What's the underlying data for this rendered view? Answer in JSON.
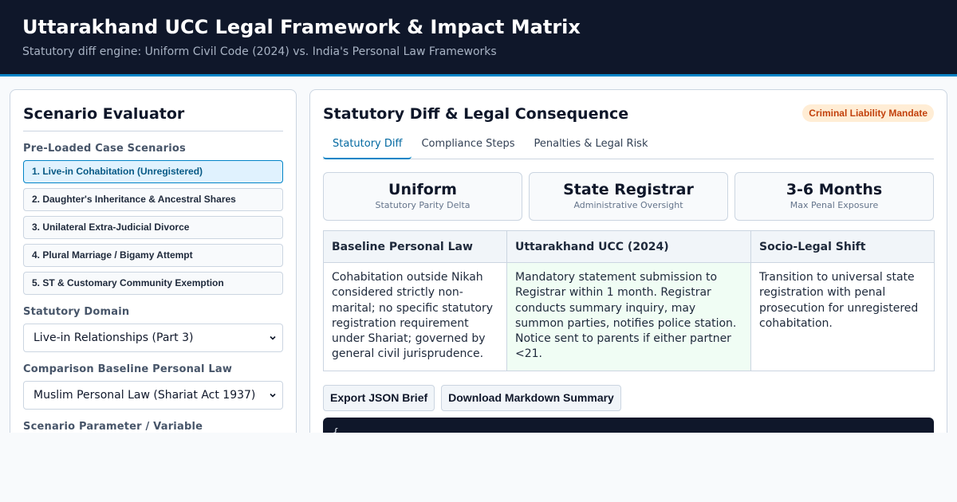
{
  "header": {
    "title": "Uttarakhand UCC Legal Framework & Impact Matrix",
    "subtitle": "Statutory diff engine: Uniform Civil Code (2024) vs. India's Personal Law Frameworks"
  },
  "evaluator": {
    "title": "Scenario Evaluator",
    "scenarios_label": "Pre-Loaded Case Scenarios",
    "scenarios": [
      "1. Live-in Cohabitation (Unregistered)",
      "2. Daughter's Inheritance & Ancestral Shares",
      "3. Unilateral Extra-Judicial Divorce",
      "4. Plural Marriage / Bigamy Attempt",
      "5. ST & Customary Community Exemption"
    ],
    "active_scenario": 0,
    "domain_label": "Statutory Domain",
    "domain_value": "Live-in Relationships (Part 3)",
    "baseline_label": "Comparison Baseline Personal Law",
    "baseline_value": "Muslim Personal Law (Shariat Act 1937)",
    "param_label": "Scenario Parameter / Variable"
  },
  "diff": {
    "title": "Statutory Diff & Legal Consequence",
    "badge": "Criminal Liability Mandate",
    "badge_color": "#c2410c",
    "tabs": [
      "Statutory Diff",
      "Compliance Steps",
      "Penalties & Legal Risk"
    ],
    "active_tab": 0,
    "stats": [
      {
        "value": "Uniform",
        "label": "Statutory Parity Delta"
      },
      {
        "value": "State Registrar",
        "label": "Administrative Oversight"
      },
      {
        "value": "3-6 Months",
        "label": "Max Penal Exposure"
      }
    ],
    "table": {
      "headers": [
        "Baseline Personal Law",
        "Uttarakhand UCC (2024)",
        "Socio-Legal Shift"
      ],
      "row": [
        "Cohabitation outside Nikah considered strictly non-marital; no specific statutory registration requirement under Shariat; governed by general civil jurisprudence.",
        "Mandatory statement submission to Registrar within 1 month. Registrar conducts summary inquiry, may summon parties, notifies police station. Notice sent to parents if either partner <21.",
        "Transition to universal state registration with penal prosecution for unregistered cohabitation."
      ]
    },
    "actions": {
      "export_json": "Export JSON Brief",
      "download_md": "Download Markdown Summary"
    },
    "code_preview": "{"
  },
  "colors": {
    "header_bg": "#0f172a",
    "accent": "#0284c7",
    "ucc_cell_bg": "#f0fdf4"
  }
}
